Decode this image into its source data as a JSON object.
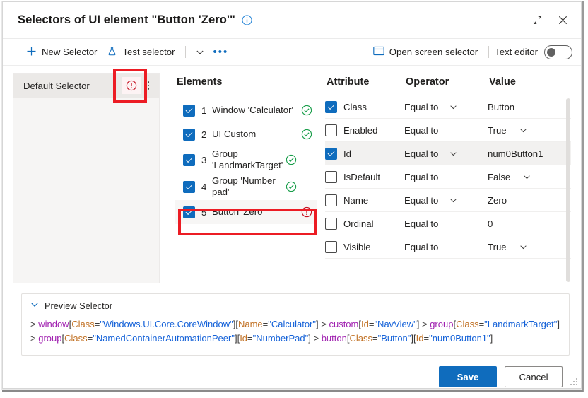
{
  "window": {
    "title": "Selectors of UI element \"Button 'Zero'\"",
    "info_icon": "info-circle-icon",
    "expand_icon": "expand-diagonal-icon",
    "close_icon": "close-x-icon"
  },
  "toolbar": {
    "new_selector": "New Selector",
    "test_selector": "Test selector",
    "chevron_icon": "chevron-down-icon",
    "overflow_icon": "ellipsis-icon",
    "open_screen_selector": "Open screen selector",
    "text_editor_label": "Text editor",
    "text_editor_on": false
  },
  "selectors_panel": {
    "items": [
      {
        "name": "Default Selector",
        "status": "error",
        "selected": true
      }
    ],
    "kebab_icon": "more-vertical-icon"
  },
  "elements": {
    "header": "Elements",
    "rows": [
      {
        "index": "1",
        "label": "Window 'Calculator'",
        "checked": true,
        "status": "ok"
      },
      {
        "index": "2",
        "label": "UI Custom",
        "checked": true,
        "status": "ok"
      },
      {
        "index": "3",
        "label": "Group 'LandmarkTarget'",
        "checked": true,
        "status": "ok"
      },
      {
        "index": "4",
        "label": "Group 'Number pad'",
        "checked": true,
        "status": "ok"
      },
      {
        "index": "5",
        "label": "Button 'Zero'",
        "checked": true,
        "status": "error",
        "selected": true
      }
    ]
  },
  "attributes": {
    "headers": {
      "attribute": "Attribute",
      "operator": "Operator",
      "value": "Value"
    },
    "rows": [
      {
        "name": "Class",
        "checked": true,
        "operator": "Equal to",
        "operator_dropdown": true,
        "value": "Button",
        "value_dropdown": false,
        "selected": false
      },
      {
        "name": "Enabled",
        "checked": false,
        "operator": "Equal to",
        "operator_dropdown": false,
        "value": "True",
        "value_dropdown": true,
        "selected": false
      },
      {
        "name": "Id",
        "checked": true,
        "operator": "Equal to",
        "operator_dropdown": true,
        "value": "num0Button1",
        "value_dropdown": false,
        "selected": true
      },
      {
        "name": "IsDefault",
        "checked": false,
        "operator": "Equal to",
        "operator_dropdown": false,
        "value": "False",
        "value_dropdown": true,
        "selected": false
      },
      {
        "name": "Name",
        "checked": false,
        "operator": "Equal to",
        "operator_dropdown": true,
        "value": "Zero",
        "value_dropdown": false,
        "selected": false
      },
      {
        "name": "Ordinal",
        "checked": false,
        "operator": "Equal to",
        "operator_dropdown": false,
        "value": "0",
        "value_dropdown": false,
        "selected": false
      },
      {
        "name": "Visible",
        "checked": false,
        "operator": "Equal to",
        "operator_dropdown": false,
        "value": "True",
        "value_dropdown": true,
        "selected": false
      }
    ]
  },
  "preview": {
    "header": "Preview Selector",
    "chevron_icon": "chevron-down-icon",
    "lines": [
      {
        "prefix": "> ",
        "tokens": [
          {
            "t": "elem",
            "s": "window"
          },
          {
            "t": "pun",
            "s": "["
          },
          {
            "t": "attr",
            "s": "Class"
          },
          {
            "t": "pun",
            "s": "="
          },
          {
            "t": "val",
            "s": "\"Windows.UI.Core.CoreWindow\""
          },
          {
            "t": "pun",
            "s": "]"
          },
          {
            "t": "pun",
            "s": "["
          },
          {
            "t": "attr",
            "s": "Name"
          },
          {
            "t": "pun",
            "s": "="
          },
          {
            "t": "val",
            "s": "\"Calculator\""
          },
          {
            "t": "pun",
            "s": "]"
          },
          {
            "t": "pun",
            "s": " > "
          },
          {
            "t": "elem",
            "s": "custom"
          },
          {
            "t": "pun",
            "s": "["
          },
          {
            "t": "attr",
            "s": "Id"
          },
          {
            "t": "pun",
            "s": "="
          },
          {
            "t": "val",
            "s": "\"NavView\""
          },
          {
            "t": "pun",
            "s": "]"
          },
          {
            "t": "pun",
            "s": " > "
          },
          {
            "t": "elem",
            "s": "group"
          },
          {
            "t": "pun",
            "s": "["
          },
          {
            "t": "attr",
            "s": "Class"
          },
          {
            "t": "pun",
            "s": "="
          },
          {
            "t": "val",
            "s": "\"LandmarkTarget\""
          },
          {
            "t": "pun",
            "s": "]"
          }
        ]
      },
      {
        "prefix": "> ",
        "tokens": [
          {
            "t": "elem",
            "s": "group"
          },
          {
            "t": "pun",
            "s": "["
          },
          {
            "t": "attr",
            "s": "Class"
          },
          {
            "t": "pun",
            "s": "="
          },
          {
            "t": "val",
            "s": "\"NamedContainerAutomationPeer\""
          },
          {
            "t": "pun",
            "s": "]"
          },
          {
            "t": "pun",
            "s": "["
          },
          {
            "t": "attr",
            "s": "Id"
          },
          {
            "t": "pun",
            "s": "="
          },
          {
            "t": "val",
            "s": "\"NumberPad\""
          },
          {
            "t": "pun",
            "s": "]"
          },
          {
            "t": "pun",
            "s": " > "
          },
          {
            "t": "elem",
            "s": "button"
          },
          {
            "t": "pun",
            "s": "["
          },
          {
            "t": "attr",
            "s": "Class"
          },
          {
            "t": "pun",
            "s": "="
          },
          {
            "t": "val",
            "s": "\"Button\""
          },
          {
            "t": "pun",
            "s": "]"
          },
          {
            "t": "pun",
            "s": "["
          },
          {
            "t": "attr",
            "s": "Id"
          },
          {
            "t": "pun",
            "s": "="
          },
          {
            "t": "val",
            "s": "\"num0Button1\""
          },
          {
            "t": "pun",
            "s": "]"
          }
        ]
      }
    ]
  },
  "footer": {
    "save": "Save",
    "cancel": "Cancel"
  },
  "colors": {
    "accent": "#0f6cbd",
    "error": "#c50f1f",
    "success": "#107c10",
    "annotation": "#ec1c24"
  }
}
